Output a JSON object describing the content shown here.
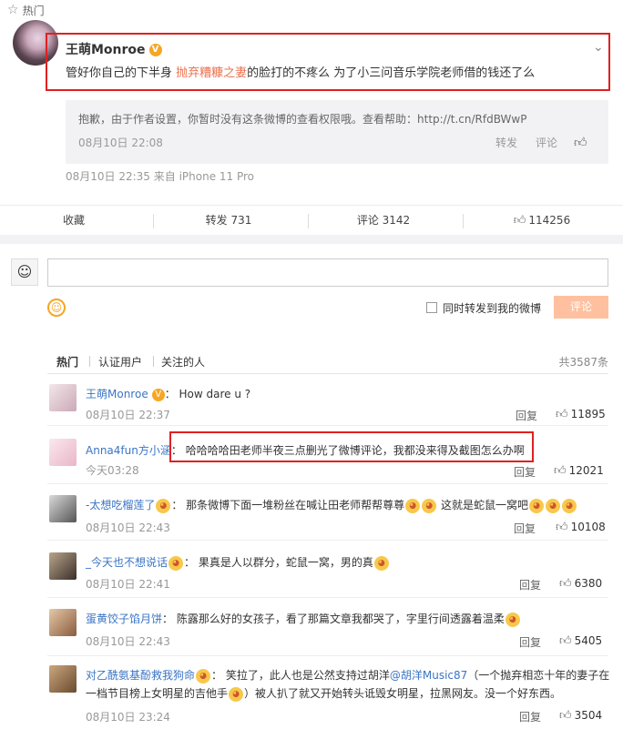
{
  "header": {
    "label": "热门"
  },
  "post": {
    "username": "王萌Monroe",
    "verified": "V",
    "text_before": "管好你自己的下半身 ",
    "text_highlight": "抛弃糟糠之妻",
    "text_after": "的脸打的不疼么 为了小三问音乐学院老师借的钱还了么",
    "quote_text": "抱歉，由于作者设置，你暂时没有这条微博的查看权限哦。查看帮助：http://t.cn/RfdBWwP",
    "quote_time": "08月10日 22:08",
    "quote_repost": "转发",
    "quote_comment": "评论",
    "time": "08月10日 22:35 来自 iPhone 11 Pro"
  },
  "actions": {
    "favorite": "收藏",
    "repost": "转发 731",
    "comment": "评论 3142",
    "like": "114256"
  },
  "compose": {
    "sync_label": "同时转发到我的微博",
    "submit_label": "评论"
  },
  "tabs": {
    "hot": "热门",
    "verified": "认证用户",
    "following": "关注的人",
    "total": "共3587条"
  },
  "comments": [
    {
      "name": "王萌Monroe",
      "badge": "V",
      "text": "How dare u ?",
      "time": "08月10日 22:37",
      "reply": "回复",
      "likes": "11895"
    },
    {
      "name": "Anna4fun方小涵",
      "text": "哈哈哈哈田老师半夜三点删光了微博评论，我都没来得及截图怎么办啊",
      "time": "今天03:28",
      "reply": "回复",
      "likes": "12021"
    },
    {
      "name": "-太想吃榴莲了",
      "text": "那条微博下面一堆粉丝在喊让田老师帮帮尊尊",
      "text2": "这就是蛇鼠一窝吧",
      "time": "08月10日 22:43",
      "reply": "回复",
      "likes": "10108"
    },
    {
      "name": "_今天也不想说话",
      "text": "果真是人以群分，蛇鼠一窝，男的真",
      "time": "08月10日 22:41",
      "reply": "回复",
      "likes": "6380"
    },
    {
      "name": "蛋黄饺子馅月饼",
      "text": "陈露那么好的女孩子，看了那篇文章我都哭了，字里行间透露着温柔",
      "time": "08月10日 22:43",
      "reply": "回复",
      "likes": "5405"
    },
    {
      "name": "对乙酰氨基酚救我狗命",
      "text_a": "笑拉了，此人也是公然支持过胡洋",
      "mention": "@胡洋Music87",
      "text_b": "（一个抛弃相恋十年的妻子在",
      "line2_a": "一档节目榜上女明星的吉他手",
      "line2_b": "）被人扒了就又开始转头诋毁女明星，拉黑网友。没一个好东西。",
      "time": "08月10日 23:24",
      "reply": "回复",
      "likes": "3504"
    }
  ],
  "colors": {
    "accent": "#eb7350",
    "link": "#3a75c4",
    "highlight_box": "#e02020",
    "submit_bg": "#ffc09f"
  }
}
